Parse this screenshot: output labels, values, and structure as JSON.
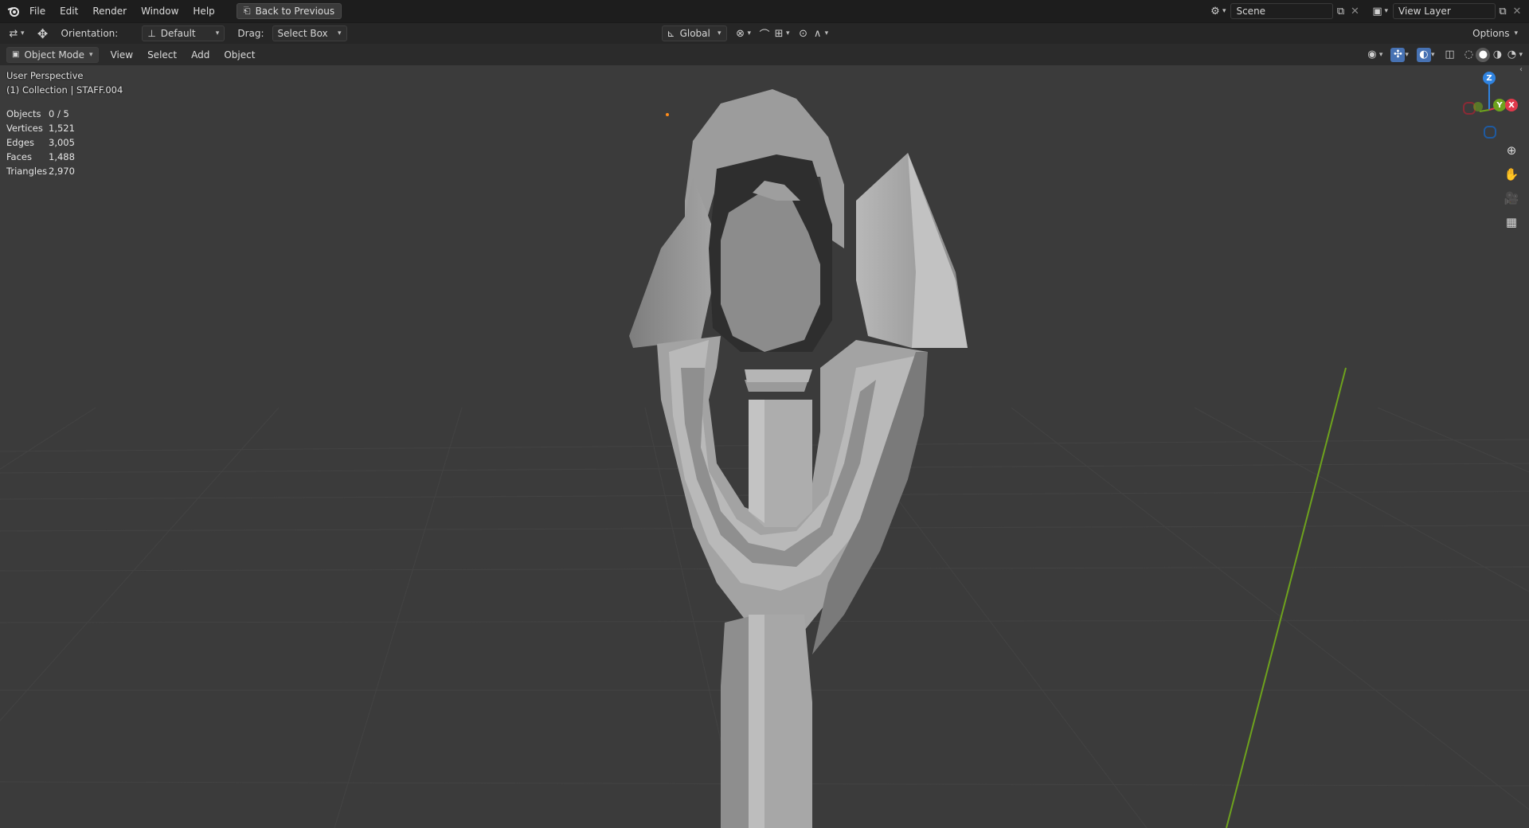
{
  "topbar": {
    "menus": [
      "File",
      "Edit",
      "Render",
      "Window",
      "Help"
    ],
    "back_button": "Back to Previous",
    "scene_name": "Scene",
    "view_layer_name": "View Layer"
  },
  "toolbar": {
    "orientation_label": "Orientation:",
    "orientation_value": "Default",
    "drag_label": "Drag:",
    "drag_value": "Select Box",
    "transform_orientation": "Global",
    "options_label": "Options"
  },
  "header": {
    "mode": "Object Mode",
    "menus": [
      "View",
      "Select",
      "Add",
      "Object"
    ]
  },
  "viewport": {
    "view_name": "User Perspective",
    "collection_info": "(1) Collection | STAFF.004",
    "stats": [
      {
        "label": "Objects",
        "value": "0 / 5"
      },
      {
        "label": "Vertices",
        "value": "1,521"
      },
      {
        "label": "Edges",
        "value": "3,005"
      },
      {
        "label": "Faces",
        "value": "1,488"
      },
      {
        "label": "Triangles",
        "value": "2,970"
      }
    ],
    "gizmo": {
      "z": "Z",
      "y": "Y",
      "x": "X"
    },
    "nav_icons": [
      "zoom-icon",
      "hand-pan-icon",
      "camera-icon",
      "grid-ortho-icon"
    ]
  },
  "colors": {
    "accent": "#4772b3",
    "axis_x": "#e0384b",
    "axis_y": "#6ea21d",
    "axis_z": "#2f83e0",
    "viewport_bg": "#3b3b3b"
  }
}
